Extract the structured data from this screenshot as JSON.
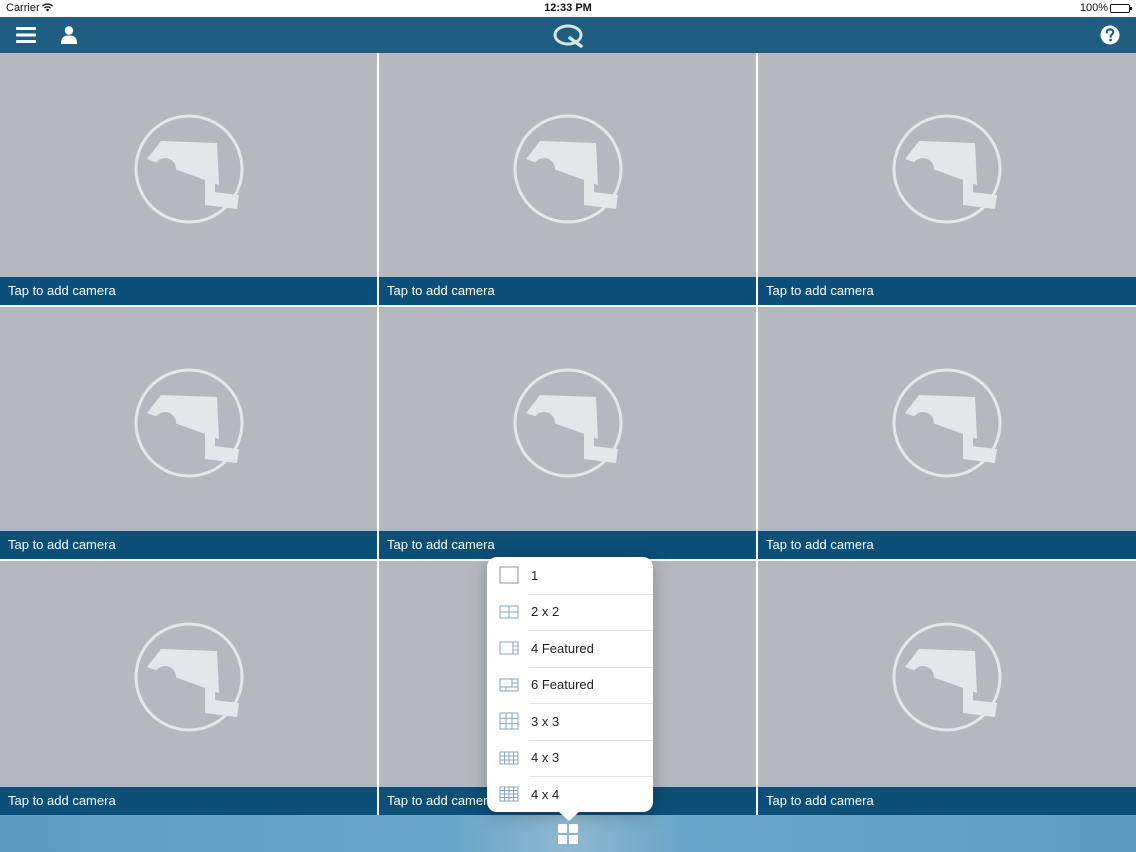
{
  "status_bar": {
    "carrier": "Carrier",
    "time": "12:33 PM",
    "battery": "100%"
  },
  "nav": {
    "menu_icon": "hamburger-icon",
    "user_icon": "user-icon",
    "logo_icon": "q-logo-icon",
    "help_icon": "help-icon"
  },
  "tiles": [
    {
      "caption": "Tap to add camera"
    },
    {
      "caption": "Tap to add camera"
    },
    {
      "caption": "Tap to add camera"
    },
    {
      "caption": "Tap to add camera"
    },
    {
      "caption": "Tap to add camera"
    },
    {
      "caption": "Tap to add camera"
    },
    {
      "caption": "Tap to add camera"
    },
    {
      "caption": "Tap to add camera"
    },
    {
      "caption": "Tap to add camera"
    }
  ],
  "layout_menu": {
    "items": [
      {
        "label": "1"
      },
      {
        "label": "2 x 2"
      },
      {
        "label": "4 Featured"
      },
      {
        "label": "6 Featured"
      },
      {
        "label": "3 x 3"
      },
      {
        "label": "4 x 3"
      },
      {
        "label": "4 x 4"
      }
    ]
  },
  "colors": {
    "nav_bar": "#1f5e80",
    "caption_bar": "#0c4f78",
    "tile_bg": "#b5b9bf",
    "bottom_bar": "#6aa6c9"
  }
}
